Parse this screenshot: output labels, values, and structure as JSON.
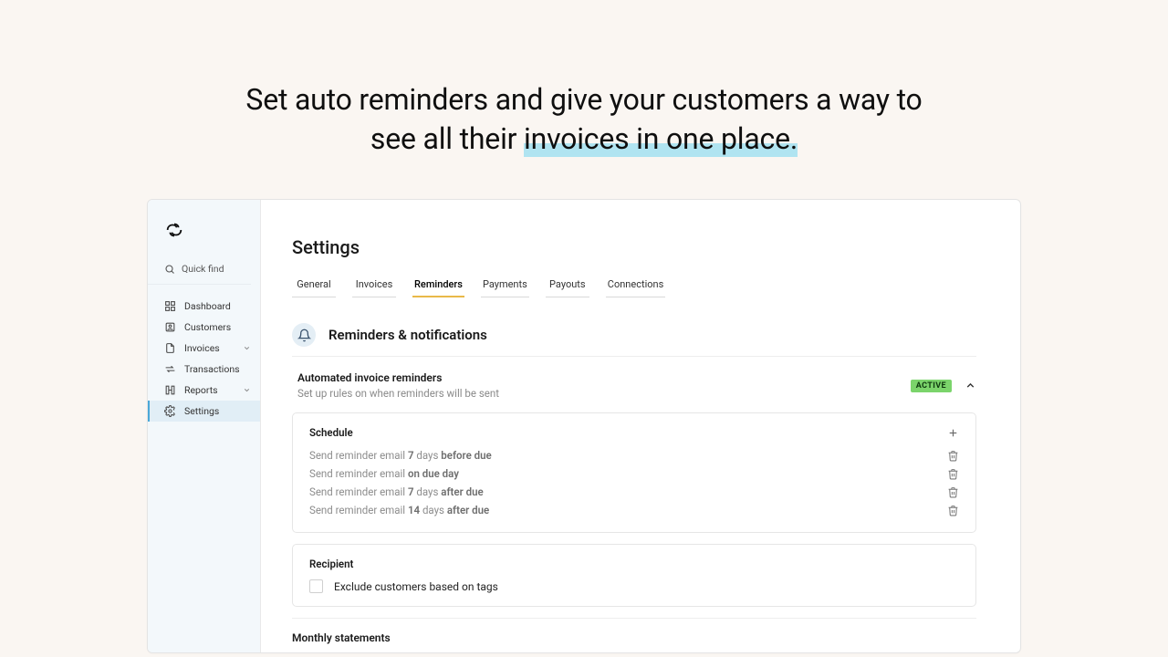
{
  "hero": {
    "line1": "Set auto reminders and give your customers a way to",
    "line2_a": "see all their ",
    "line2_b": "invoices in one place."
  },
  "sidebar": {
    "quick_find": "Quick find",
    "items": [
      {
        "label": "Dashboard",
        "icon": "grid"
      },
      {
        "label": "Customers",
        "icon": "user"
      },
      {
        "label": "Invoices",
        "icon": "file",
        "expandable": true
      },
      {
        "label": "Transactions",
        "icon": "swap"
      },
      {
        "label": "Reports",
        "icon": "book",
        "expandable": true
      },
      {
        "label": "Settings",
        "icon": "gear",
        "active": true
      }
    ]
  },
  "page": {
    "title": "Settings",
    "tabs": [
      "General",
      "Invoices",
      "Reminders",
      "Payments",
      "Payouts",
      "Connections"
    ],
    "active_tab": "Reminders"
  },
  "section": {
    "title": "Reminders & notifications"
  },
  "auto_reminders": {
    "heading": "Automated invoice reminders",
    "description": "Set up rules on when reminders will be sent",
    "status": "ACTIVE"
  },
  "schedule": {
    "title": "Schedule",
    "rules": [
      {
        "prefix": "Send reminder email ",
        "n": "7",
        "unit": " days ",
        "suffix": "before due"
      },
      {
        "prefix": "Send reminder email ",
        "n": "",
        "unit": "",
        "suffix": "on due day"
      },
      {
        "prefix": "Send reminder email ",
        "n": "7",
        "unit": " days ",
        "suffix": "after due"
      },
      {
        "prefix": "Send reminder email ",
        "n": "14",
        "unit": " days ",
        "suffix": "after due"
      }
    ]
  },
  "recipient": {
    "title": "Recipient",
    "exclude_label": "Exclude customers based on tags"
  },
  "statements": {
    "title": "Monthly statements"
  }
}
